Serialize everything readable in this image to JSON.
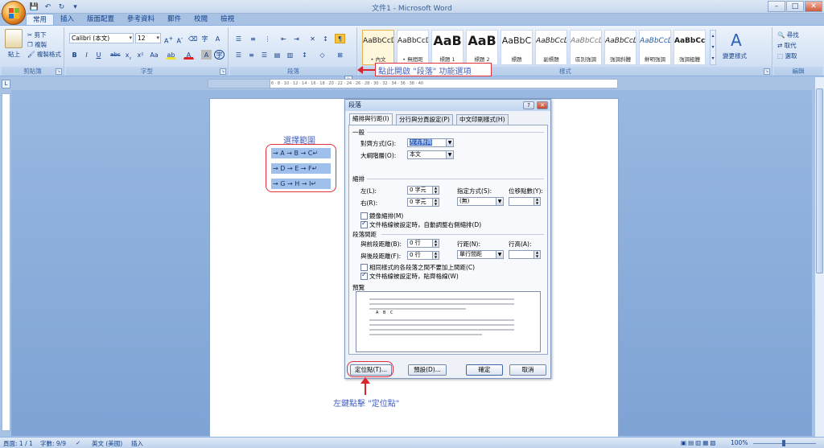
{
  "window": {
    "title": "文件1 - Microsoft Word"
  },
  "qat": {
    "save": "💾",
    "undo": "↶",
    "redo": "↻",
    "more": "▾"
  },
  "tabs": [
    "常用",
    "插入",
    "版面配置",
    "參考資料",
    "郵件",
    "校閱",
    "檢視"
  ],
  "ribbon": {
    "clipboard": {
      "label": "剪貼簿",
      "paste": "貼上",
      "cut": "剪下",
      "copy": "複製",
      "format_painter": "複製格式"
    },
    "font": {
      "label": "字型",
      "font_name": "Calibri (本文)",
      "font_size": "12"
    },
    "paragraph": {
      "label": "段落"
    },
    "styles": {
      "label": "樣式",
      "items": [
        {
          "preview": "AaBbCcD",
          "name": "• 內文"
        },
        {
          "preview": "AaBbCcD",
          "name": "• 無間距"
        },
        {
          "preview": "AaB",
          "name": "標題 1"
        },
        {
          "preview": "AaB",
          "name": "標題 2"
        },
        {
          "preview": "AaBbC",
          "name": "標題"
        },
        {
          "preview": "AaBbCcD",
          "name": "副標題"
        },
        {
          "preview": "AaBbCcD",
          "name": "區別強調"
        },
        {
          "preview": "AaBbCcD",
          "name": "強調斜體"
        },
        {
          "preview": "AaBbCcD",
          "name": "鮮明強調"
        },
        {
          "preview": "AaBbCcD",
          "name": "強調粗體"
        }
      ],
      "change_styles": "變更樣式"
    },
    "editing": {
      "label": "編輯",
      "find": "尋找",
      "replace": "取代",
      "select": "選取"
    }
  },
  "annotations": {
    "launcher_hint": "點此開啟 \"段落\" 功能選項",
    "select_range": "選擇範圍",
    "tabs_hint": "左鍵點擊 \"定位點\""
  },
  "selection_rows": [
    "→ A → B → C↵",
    "→ D → E → F↵",
    "→ G → H → I↵"
  ],
  "dialog": {
    "title": "段落",
    "help": "?",
    "close": "✕",
    "tabs": [
      "縮排與行距(I)",
      "分行與分頁設定(P)",
      "中文印刷樣式(H)"
    ],
    "general": {
      "heading": "一般",
      "alignment_label": "對齊方式(G):",
      "alignment_value": "左右對齊",
      "outline_label": "大綱階層(O):",
      "outline_value": "本文"
    },
    "indent": {
      "heading": "縮排",
      "left_label": "左(L):",
      "left_value": "0 字元",
      "right_label": "右(R):",
      "right_value": "0 字元",
      "special_label": "指定方式(S):",
      "special_value": "(無)",
      "by_label": "位移點數(Y):",
      "by_value": "",
      "mirror": "鏡像縮排(M)",
      "auto_adjust": "文件格線被設定時，自動調整右側縮排(D)"
    },
    "spacing": {
      "heading": "段落間距",
      "before_label": "與前段距離(B):",
      "before_value": "0 行",
      "after_label": "與後段距離(F):",
      "after_value": "0 行",
      "line_label": "行距(N):",
      "line_value": "單行間距",
      "at_label": "行高(A):",
      "at_value": "",
      "no_space": "相同樣式的各段落之間不要加上間距(C)",
      "snap_grid": "文件格線被設定時，貼齊格線(W)"
    },
    "preview": {
      "heading": "預覽",
      "sample": "A B C"
    },
    "buttons": {
      "tabs": "定位點(T)...",
      "default": "預設(D)...",
      "ok": "確定",
      "cancel": "取消"
    }
  },
  "statusbar": {
    "page": "頁面: 1 / 1",
    "words": "字數: 9/9",
    "language": "英文 (美國)",
    "mode": "插入",
    "zoom": "100%"
  }
}
